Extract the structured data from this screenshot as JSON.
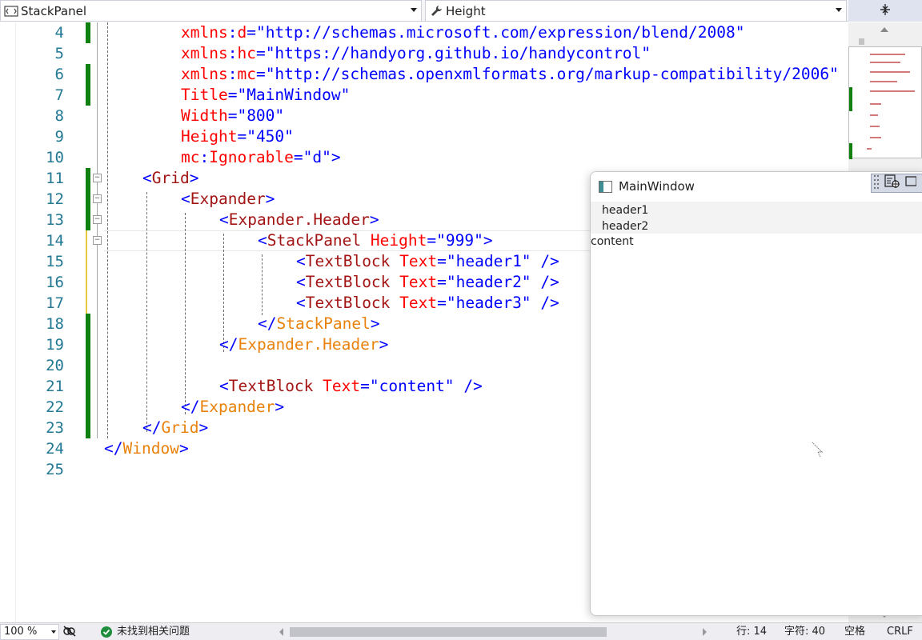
{
  "navbar": {
    "type_combo": "StackPanel",
    "member_combo": "Height"
  },
  "editor": {
    "lines": [
      {
        "num": "4",
        "text": "xmlns:d=\"http://schemas.microsoft.com/expression/blend/2008\""
      },
      {
        "num": "5",
        "text": "xmlns:hc=\"https://handyorg.github.io/handycontrol\""
      },
      {
        "num": "6",
        "text": "xmlns:mc=\"http://schemas.openxmlformats.org/markup-compatibility/2006\""
      },
      {
        "num": "7",
        "text": "Title=\"MainWindow\""
      },
      {
        "num": "8",
        "text": "Width=\"800\""
      },
      {
        "num": "9",
        "text": "Height=\"450\""
      },
      {
        "num": "10",
        "text": "mc:Ignorable=\"d\">"
      },
      {
        "num": "11",
        "text": "<Grid>"
      },
      {
        "num": "12",
        "text": "<Expander>"
      },
      {
        "num": "13",
        "text": "<Expander.Header>"
      },
      {
        "num": "14",
        "text": "<StackPanel Height=\"999\">"
      },
      {
        "num": "15",
        "text": "<TextBlock Text=\"header1\" />"
      },
      {
        "num": "16",
        "text": "<TextBlock Text=\"header2\" />"
      },
      {
        "num": "17",
        "text": "<TextBlock Text=\"header3\" />"
      },
      {
        "num": "18",
        "text": "</StackPanel>"
      },
      {
        "num": "19",
        "text": "</Expander.Header>"
      },
      {
        "num": "20",
        "text": ""
      },
      {
        "num": "21",
        "text": "<TextBlock Text=\"content\" />"
      },
      {
        "num": "22",
        "text": "</Expander>"
      },
      {
        "num": "23",
        "text": "</Grid>"
      },
      {
        "num": "24",
        "text": "</Window>"
      },
      {
        "num": "25",
        "text": ""
      }
    ]
  },
  "preview": {
    "title": "MainWindow",
    "header1": "header1",
    "header2": "header2",
    "content": "content"
  },
  "statusbar": {
    "zoom": "100 %",
    "issues": "未找到相关问题",
    "line": "行: 14",
    "char": "字符: 40",
    "spacing": "空格",
    "eol": "CRLF"
  },
  "colors": {
    "change_saved": "#108010",
    "change_dirty": "#e8c93a",
    "line_number": "#237893",
    "tag": "#a31515",
    "attr_value": "#0000ff",
    "close_tag": "#e8820c"
  }
}
